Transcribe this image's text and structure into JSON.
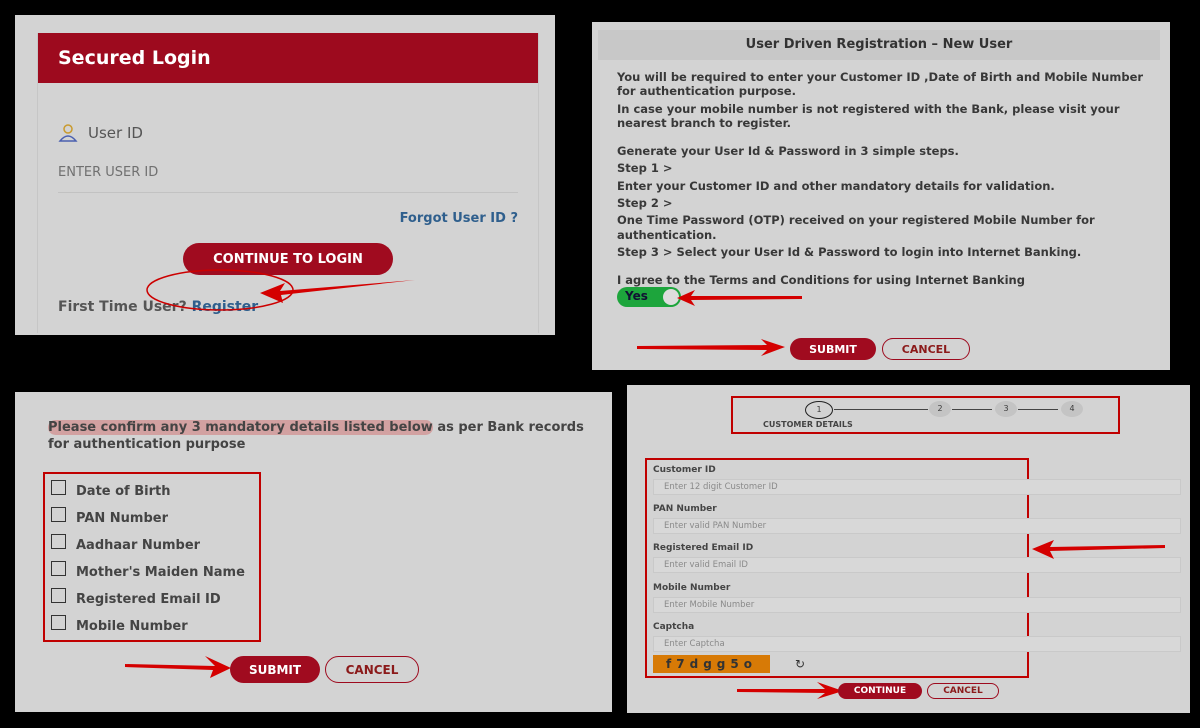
{
  "login": {
    "title": "Secured Login",
    "user_id_label": "User ID",
    "user_id_placeholder": "ENTER USER ID",
    "forgot_link": "Forgot User ID ?",
    "continue_button": "CONTINUE TO LOGIN",
    "first_time_text": "First Time User?",
    "register_link": "Register"
  },
  "registration": {
    "title": "User Driven Registration – New User",
    "intro1": "You will be required to enter your Customer ID ,Date of Birth and Mobile Number for authentication purpose.",
    "intro2": "In case your mobile number is not registered with the Bank, please visit your nearest branch to register.",
    "steps_heading": "Generate your User Id & Password in 3 simple steps.",
    "step1_label": "Step 1 >",
    "step1_text": "Enter your Customer ID and other mandatory details for validation.",
    "step2_label": "Step 2 >",
    "step2_text": "One Time Password (OTP) received on your registered Mobile Number for authentication.",
    "step3_label": "Step 3 >",
    "step3_text": "Select your User Id & Password to login into Internet Banking.",
    "terms_text": "I agree to the Terms and Conditions for using Internet Banking",
    "toggle_label": "Yes",
    "submit_button": "SUBMIT",
    "cancel_button": "CANCEL"
  },
  "confirm": {
    "intro_highlight": "Please confirm any 3 mandatory details listed below",
    "intro_rest": " as per Bank records for authentication purpose",
    "options": [
      {
        "label": "Date of Birth"
      },
      {
        "label": "PAN Number"
      },
      {
        "label": "Aadhaar Number"
      },
      {
        "label": "Mother's Maiden Name"
      },
      {
        "label": "Registered Email ID"
      },
      {
        "label": "Mobile Number"
      }
    ],
    "submit_button": "SUBMIT",
    "cancel_button": "CANCEL"
  },
  "customer_details": {
    "steps": [
      "1",
      "2",
      "3",
      "4"
    ],
    "active_step_label": "CUSTOMER DETAILS",
    "fields": [
      {
        "label": "Customer ID",
        "placeholder": "Enter 12 digit Customer ID"
      },
      {
        "label": "PAN Number",
        "placeholder": "Enter valid PAN Number"
      },
      {
        "label": "Registered Email ID",
        "placeholder": "Enter valid Email ID"
      },
      {
        "label": "Mobile Number",
        "placeholder": "Enter Mobile Number"
      },
      {
        "label": "Captcha",
        "placeholder": "Enter Captcha"
      }
    ],
    "captcha_text": "f7dgg5o",
    "refresh_icon": "↻",
    "continue_button": "CONTINUE",
    "cancel_button": "CANCEL"
  }
}
